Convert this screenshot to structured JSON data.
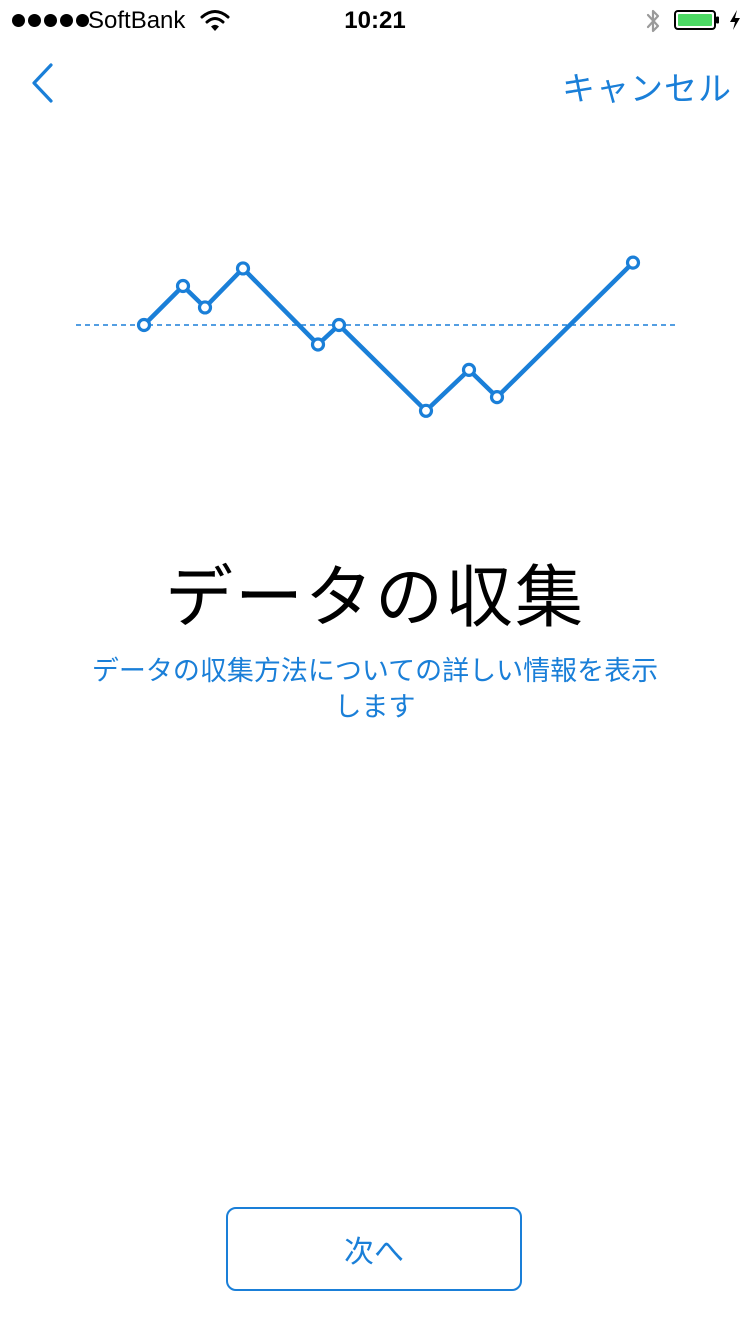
{
  "status_bar": {
    "carrier": "SoftBank",
    "time": "10:21",
    "signal_bars": 5
  },
  "nav": {
    "back_icon": "chevron-left-icon",
    "cancel_label": "キャンセル"
  },
  "colors": {
    "accent": "#1a7fd8",
    "battery_fill": "#4cd964"
  },
  "illustration": {
    "type": "line",
    "icon": "data-trend-illustration",
    "points": [
      [
        0,
        0
      ],
      [
        1,
        1
      ],
      [
        2,
        0.45
      ],
      [
        3,
        1.45
      ],
      [
        4,
        -0.5
      ],
      [
        5,
        0
      ],
      [
        6,
        -2.2
      ],
      [
        7,
        -1.15
      ],
      [
        8,
        -1.85
      ],
      [
        9,
        1.6
      ]
    ],
    "baseline": 0
  },
  "main": {
    "title": "データの収集",
    "description": "データの収集方法についての詳しい情報を表示します"
  },
  "footer": {
    "next_label": "次へ"
  }
}
